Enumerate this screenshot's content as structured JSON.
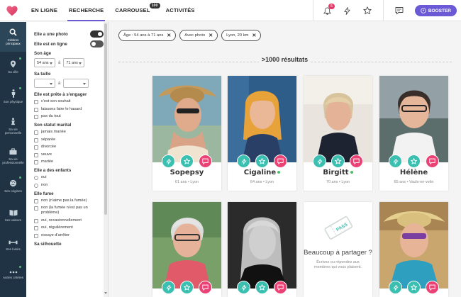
{
  "topbar": {
    "nav": [
      {
        "label": "EN LIGNE"
      },
      {
        "label": "RECHERCHE",
        "active": true
      },
      {
        "label": "CARROUSEL",
        "badge": "100"
      },
      {
        "label": "ACTIVITÉS"
      }
    ],
    "notif_count": "5",
    "booster_label": "BOOSTER",
    "accent": "#6a5ad6"
  },
  "sidebar": {
    "items": [
      {
        "label": "Critères principaux",
        "icon": "search-icon",
        "dot": false
      },
      {
        "label": "Sa ville",
        "icon": "location-pin-icon",
        "dot": true
      },
      {
        "label": "Son physique",
        "icon": "person-icon",
        "dot": true
      },
      {
        "label": "Sa vie personnelle",
        "icon": "family-icon",
        "dot": false
      },
      {
        "label": "Sa vie professionnelle",
        "icon": "briefcase-icon",
        "dot": false
      },
      {
        "label": "Ses origines",
        "icon": "globe-icon",
        "dot": true
      },
      {
        "label": "Ses valeurs",
        "icon": "book-icon",
        "dot": false
      },
      {
        "label": "Ses loisirs",
        "icon": "dumbbell-icon",
        "dot": false
      },
      {
        "label": "Autres critères",
        "icon": "more-icon",
        "dot": true
      }
    ]
  },
  "filters": {
    "photo_label": "Elle a une photo",
    "online_label": "Elle est en ligne",
    "age_title": "Son âge",
    "age_min": "54 ans",
    "age_sep": "à",
    "age_max": "71 ans",
    "height_title": "Sa taille",
    "height_sep": "à",
    "engage_title": "Elle est prête à s'engager",
    "engage_options": [
      "c'est son souhait",
      "laissons faire le hasard",
      "pas du tout"
    ],
    "marital_title": "Son statut marital",
    "marital_options": [
      "jamais mariée",
      "séparée",
      "divorcée",
      "veuve",
      "mariée"
    ],
    "kids_title": "Elle a des enfants",
    "kids_options": [
      "oui",
      "non"
    ],
    "smoke_title": "Elle fume",
    "smoke_options": [
      "non (n'aime pas la fumée)",
      "non (la fumée n'est pas un problème)",
      "oui, occasionnellement",
      "oui, régulièrement",
      "essaye d'arrêter"
    ],
    "silhouette_title": "Sa silhouette"
  },
  "tags": [
    {
      "label": "Âge : 54 ans à 71 ans"
    },
    {
      "label": "Avec photo"
    },
    {
      "label": "Lyon, 20 km"
    }
  ],
  "results_label": ">1000 résultats",
  "profiles": [
    {
      "name": "Sopepsy",
      "meta": "61 ans • Lyon",
      "online": false
    },
    {
      "name": "Cigaline",
      "meta": "64 ans • Lyon",
      "online": true
    },
    {
      "name": "Birgitt",
      "meta": "70 ans • Lyon",
      "online": true
    },
    {
      "name": "Hélène",
      "meta": "65 ans • Vaulx-en-velin",
      "online": false
    }
  ],
  "promo": {
    "title": "Beaucoup à partager ?",
    "text": "Écrivez ou répondez aux membres qui vous plaisent.",
    "pass_label": "PASS"
  },
  "colors": {
    "teal": "#3bbfb0",
    "pink": "#ea4275",
    "sidebar": "#1f3344",
    "online": "#4cc06a"
  }
}
